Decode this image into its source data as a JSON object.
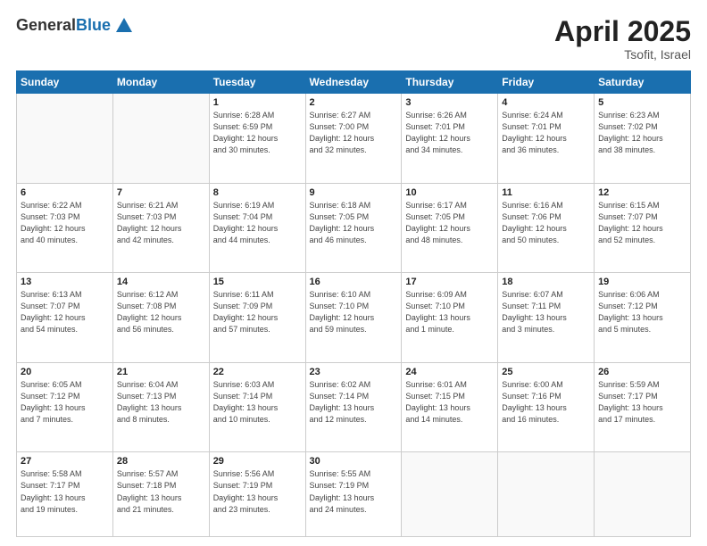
{
  "header": {
    "logo_line1": "General",
    "logo_line2": "Blue",
    "month": "April 2025",
    "location": "Tsofit, Israel"
  },
  "weekdays": [
    "Sunday",
    "Monday",
    "Tuesday",
    "Wednesday",
    "Thursday",
    "Friday",
    "Saturday"
  ],
  "weeks": [
    [
      {
        "day": "",
        "info": ""
      },
      {
        "day": "",
        "info": ""
      },
      {
        "day": "1",
        "info": "Sunrise: 6:28 AM\nSunset: 6:59 PM\nDaylight: 12 hours\nand 30 minutes."
      },
      {
        "day": "2",
        "info": "Sunrise: 6:27 AM\nSunset: 7:00 PM\nDaylight: 12 hours\nand 32 minutes."
      },
      {
        "day": "3",
        "info": "Sunrise: 6:26 AM\nSunset: 7:01 PM\nDaylight: 12 hours\nand 34 minutes."
      },
      {
        "day": "4",
        "info": "Sunrise: 6:24 AM\nSunset: 7:01 PM\nDaylight: 12 hours\nand 36 minutes."
      },
      {
        "day": "5",
        "info": "Sunrise: 6:23 AM\nSunset: 7:02 PM\nDaylight: 12 hours\nand 38 minutes."
      }
    ],
    [
      {
        "day": "6",
        "info": "Sunrise: 6:22 AM\nSunset: 7:03 PM\nDaylight: 12 hours\nand 40 minutes."
      },
      {
        "day": "7",
        "info": "Sunrise: 6:21 AM\nSunset: 7:03 PM\nDaylight: 12 hours\nand 42 minutes."
      },
      {
        "day": "8",
        "info": "Sunrise: 6:19 AM\nSunset: 7:04 PM\nDaylight: 12 hours\nand 44 minutes."
      },
      {
        "day": "9",
        "info": "Sunrise: 6:18 AM\nSunset: 7:05 PM\nDaylight: 12 hours\nand 46 minutes."
      },
      {
        "day": "10",
        "info": "Sunrise: 6:17 AM\nSunset: 7:05 PM\nDaylight: 12 hours\nand 48 minutes."
      },
      {
        "day": "11",
        "info": "Sunrise: 6:16 AM\nSunset: 7:06 PM\nDaylight: 12 hours\nand 50 minutes."
      },
      {
        "day": "12",
        "info": "Sunrise: 6:15 AM\nSunset: 7:07 PM\nDaylight: 12 hours\nand 52 minutes."
      }
    ],
    [
      {
        "day": "13",
        "info": "Sunrise: 6:13 AM\nSunset: 7:07 PM\nDaylight: 12 hours\nand 54 minutes."
      },
      {
        "day": "14",
        "info": "Sunrise: 6:12 AM\nSunset: 7:08 PM\nDaylight: 12 hours\nand 56 minutes."
      },
      {
        "day": "15",
        "info": "Sunrise: 6:11 AM\nSunset: 7:09 PM\nDaylight: 12 hours\nand 57 minutes."
      },
      {
        "day": "16",
        "info": "Sunrise: 6:10 AM\nSunset: 7:10 PM\nDaylight: 12 hours\nand 59 minutes."
      },
      {
        "day": "17",
        "info": "Sunrise: 6:09 AM\nSunset: 7:10 PM\nDaylight: 13 hours\nand 1 minute."
      },
      {
        "day": "18",
        "info": "Sunrise: 6:07 AM\nSunset: 7:11 PM\nDaylight: 13 hours\nand 3 minutes."
      },
      {
        "day": "19",
        "info": "Sunrise: 6:06 AM\nSunset: 7:12 PM\nDaylight: 13 hours\nand 5 minutes."
      }
    ],
    [
      {
        "day": "20",
        "info": "Sunrise: 6:05 AM\nSunset: 7:12 PM\nDaylight: 13 hours\nand 7 minutes."
      },
      {
        "day": "21",
        "info": "Sunrise: 6:04 AM\nSunset: 7:13 PM\nDaylight: 13 hours\nand 8 minutes."
      },
      {
        "day": "22",
        "info": "Sunrise: 6:03 AM\nSunset: 7:14 PM\nDaylight: 13 hours\nand 10 minutes."
      },
      {
        "day": "23",
        "info": "Sunrise: 6:02 AM\nSunset: 7:14 PM\nDaylight: 13 hours\nand 12 minutes."
      },
      {
        "day": "24",
        "info": "Sunrise: 6:01 AM\nSunset: 7:15 PM\nDaylight: 13 hours\nand 14 minutes."
      },
      {
        "day": "25",
        "info": "Sunrise: 6:00 AM\nSunset: 7:16 PM\nDaylight: 13 hours\nand 16 minutes."
      },
      {
        "day": "26",
        "info": "Sunrise: 5:59 AM\nSunset: 7:17 PM\nDaylight: 13 hours\nand 17 minutes."
      }
    ],
    [
      {
        "day": "27",
        "info": "Sunrise: 5:58 AM\nSunset: 7:17 PM\nDaylight: 13 hours\nand 19 minutes."
      },
      {
        "day": "28",
        "info": "Sunrise: 5:57 AM\nSunset: 7:18 PM\nDaylight: 13 hours\nand 21 minutes."
      },
      {
        "day": "29",
        "info": "Sunrise: 5:56 AM\nSunset: 7:19 PM\nDaylight: 13 hours\nand 23 minutes."
      },
      {
        "day": "30",
        "info": "Sunrise: 5:55 AM\nSunset: 7:19 PM\nDaylight: 13 hours\nand 24 minutes."
      },
      {
        "day": "",
        "info": ""
      },
      {
        "day": "",
        "info": ""
      },
      {
        "day": "",
        "info": ""
      }
    ]
  ]
}
